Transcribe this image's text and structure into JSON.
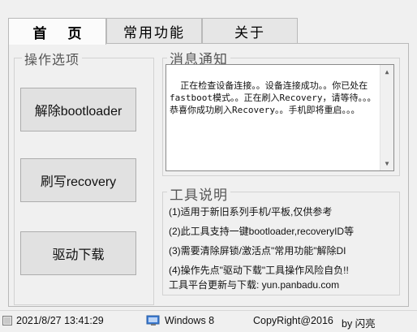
{
  "tabs": [
    {
      "label": "首 页",
      "active": true
    },
    {
      "label": "常用功能",
      "active": false
    },
    {
      "label": "关于",
      "active": false
    }
  ],
  "operations": {
    "title": "操作选项",
    "buttons": [
      "解除bootloader",
      "刷写recovery",
      "驱动下载"
    ]
  },
  "messages": {
    "title": "消息通知",
    "text": "正在检查设备连接。。设备连接成功。。你已处在fastboot模式。。正在刷入Recovery，请等待。。。恭喜你成功刷入Recovery。。手机即将重启。。。"
  },
  "tools": {
    "title": "工具说明",
    "lines": [
      "(1)适用于新旧系列手机/平板,仅供参考",
      "(2)此工具支持一键bootloader,recoveryID等",
      "(3)需要清除屏锁/激活点\"常用功能\"解除DI",
      "(4)操作先点\"驱动下载\"工具操作风险自负!!",
      "工具平台更新与下载: yun.panbadu.com"
    ]
  },
  "status": {
    "datetime": "2021/8/27 13:41:29",
    "os": "Windows 8",
    "copyright": "CopyRight@2016",
    "author": "by 闪亮"
  },
  "icons": {
    "status_left": "status-panel-icon",
    "status_os": "monitor-icon"
  },
  "colors": {
    "background": "#f0f0f0",
    "button": "#e1e1e1",
    "border": "#adadad",
    "textarea": "#ffffff"
  }
}
